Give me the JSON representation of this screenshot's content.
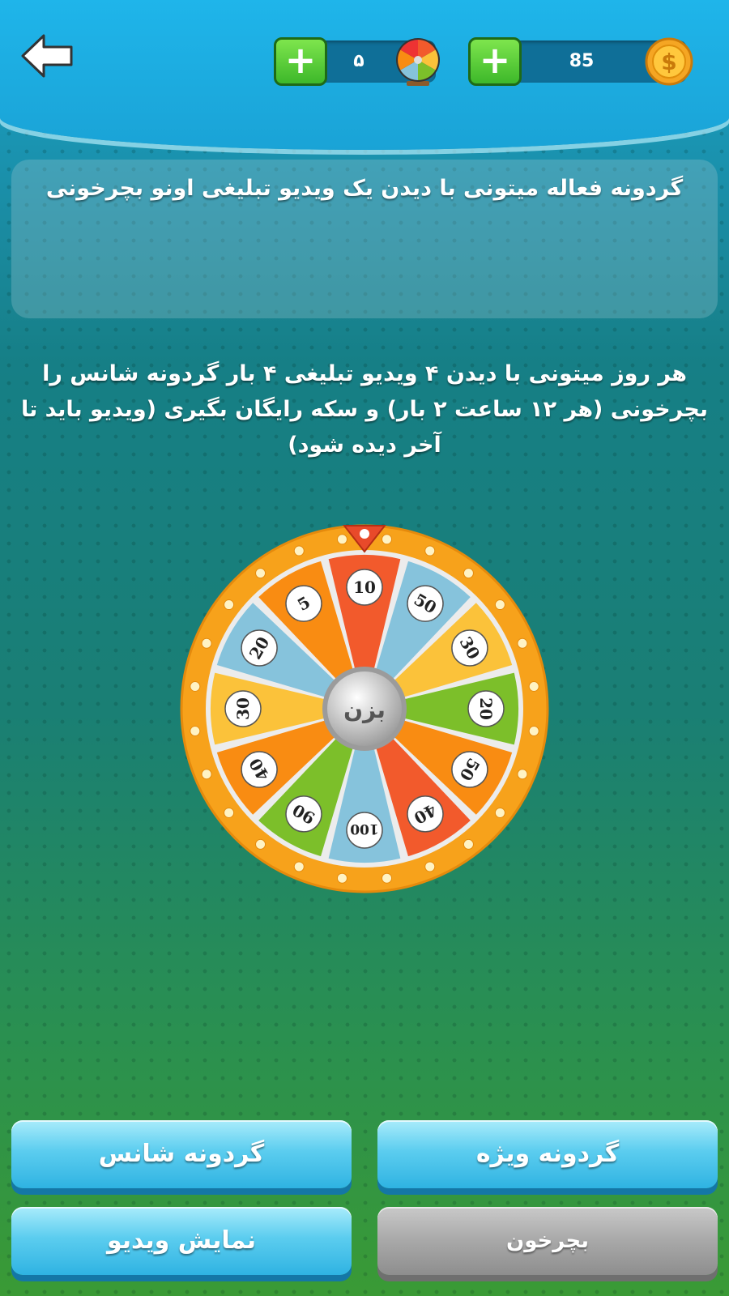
{
  "header": {
    "spins": {
      "value": "۵",
      "plus_label": "+"
    },
    "coins": {
      "value": "85",
      "plus_label": "+"
    }
  },
  "info_text": "گردونه فعاله میتونی با دیدن یک ویدیو تبلیغی اونو بچرخونی",
  "rules_text": "هر روز میتونی با دیدن ۴ ویدیو تبلیغی ۴ بار گردونه شانس را بچرخونی (هر ۱۲ ساعت ۲ بار) و سکه رایگان بگیری (ویدیو باید تا آخر دیده شود)",
  "wheel": {
    "center_label": "بزن",
    "segments": [
      {
        "value": "10",
        "color": "#f25a2c"
      },
      {
        "value": "50",
        "color": "#86c3dc"
      },
      {
        "value": "30",
        "color": "#fbc23a"
      },
      {
        "value": "20",
        "color": "#7cbf2a"
      },
      {
        "value": "50",
        "color": "#f98c12"
      },
      {
        "value": "40",
        "color": "#f25a2c"
      },
      {
        "value": "100",
        "color": "#86c3dc"
      },
      {
        "value": "90",
        "color": "#7cbf2a"
      },
      {
        "value": "40",
        "color": "#f98c12"
      },
      {
        "value": "30",
        "color": "#fbc23a"
      },
      {
        "value": "20",
        "color": "#86c3dc"
      },
      {
        "value": "5",
        "color": "#f98c12"
      }
    ]
  },
  "buttons": {
    "special_wheel": "گردونه ویژه",
    "lucky_wheel": "گردونه شانس",
    "spin": "بچرخون",
    "show_video": "نمایش ویدیو"
  },
  "colors": {
    "header": "#1fb5ea",
    "plus_button": "#3db82a",
    "button_blue": "#2fb3e2",
    "button_gray": "#a8a8a8",
    "wheel_rim": "#f9a91b"
  }
}
